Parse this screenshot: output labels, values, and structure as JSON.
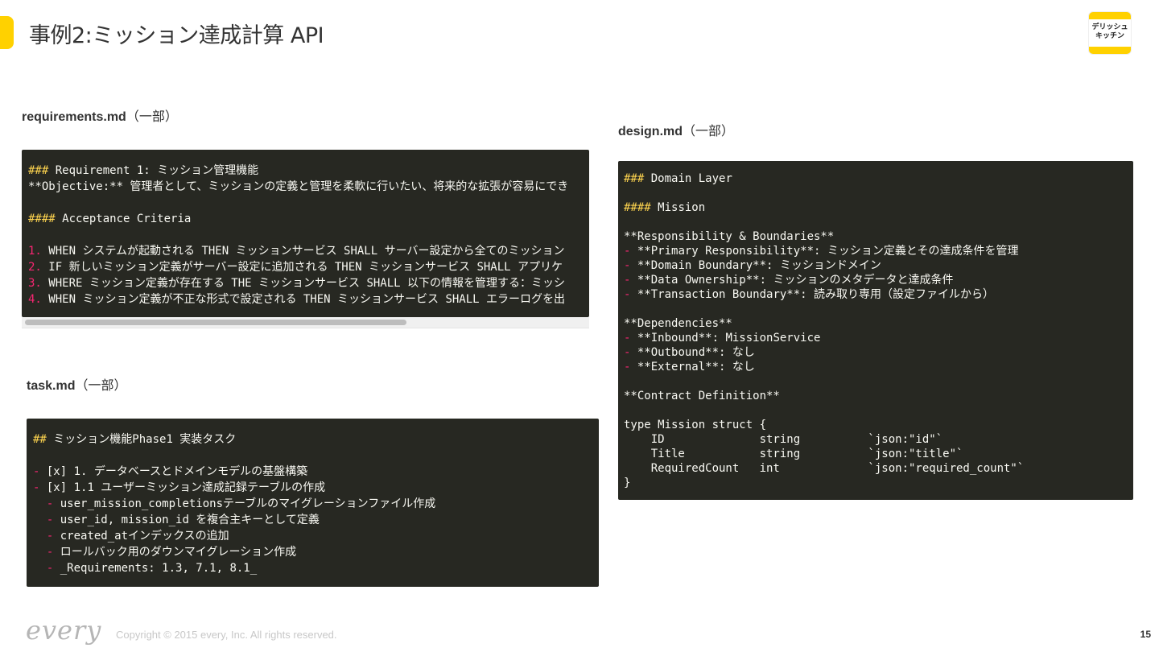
{
  "slide": {
    "title": "事例2:ミッション達成計算 API",
    "logo_line1": "デリッシュ",
    "logo_line2": "キッチン",
    "page_number": "15"
  },
  "footer": {
    "brand": "every",
    "copyright": "Copyright © 2015 every, Inc. All rights reserved."
  },
  "requirements": {
    "filename": "requirements.md",
    "suffix": "（一部）",
    "lines": [
      "Requirement 1: ミッション管理機能",
      "**Objective:** 管理者として、ミッションの定義と管理を柔軟に行いたい、将来的な拡張が容易にでき",
      "",
      "Acceptance Criteria",
      "",
      "WHEN システムが起動される THEN ミッションサービス SHALL サーバー設定から全てのミッション",
      "IF 新しいミッション定義がサーバー設定に追加される THEN ミッションサービス SHALL アプリケ",
      "WHERE ミッション定義が存在する THE ミッションサービス SHALL 以下の情報を管理する：ミッシ",
      "WHEN ミッション定義が不正な形式で設定される THEN ミッションサービス SHALL エラーログを出"
    ],
    "markers": [
      "###",
      "####",
      "1.",
      "2.",
      "3.",
      "4."
    ]
  },
  "task": {
    "filename": "task.md",
    "suffix": "（一部）",
    "lines": [
      "ミッション機能Phase1 実装タスク",
      "",
      "[x] 1. データベースとドメインモデルの基盤構築",
      "[x] 1.1 ユーザーミッション達成記録テーブルの作成",
      "user_mission_completionsテーブルのマイグレーションファイル作成",
      "user_id, mission_id を複合主キーとして定義",
      "created_atインデックスの追加",
      "ロールバック用のダウンマイグレーション作成",
      "_Requirements: 1.3, 7.1, 8.1_"
    ],
    "markers": [
      "##",
      "-"
    ]
  },
  "design": {
    "filename": "design.md",
    "suffix": "（一部）",
    "lines": [
      "Domain Layer",
      "",
      "Mission",
      "",
      "**Responsibility & Boundaries**",
      "**Primary Responsibility**: ミッション定義とその達成条件を管理",
      "**Domain Boundary**: ミッションドメイン",
      "**Data Ownership**: ミッションのメタデータと達成条件",
      "**Transaction Boundary**: 読み取り専用（設定ファイルから）",
      "",
      "**Dependencies**",
      "**Inbound**: MissionService",
      "**Outbound**: なし",
      "**External**: なし",
      "",
      "**Contract Definition**",
      "",
      "type Mission struct {",
      "    ID              string          `json:\"id\"`",
      "    Title           string          `json:\"title\"`",
      "    RequiredCount   int             `json:\"required_count\"`",
      "}"
    ],
    "markers": [
      "###",
      "####",
      "-"
    ]
  },
  "colors": {
    "accent": "#FFD100",
    "code_background": "#272822",
    "code_text": "#f8f8f2",
    "heading_marker": "#FFD54F",
    "list_marker": "#F92672"
  }
}
